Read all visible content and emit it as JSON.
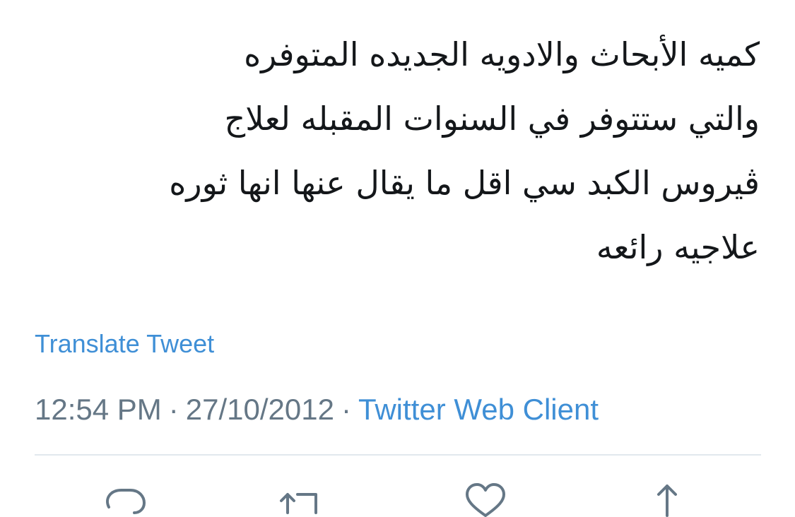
{
  "tweet": {
    "text_lines": [
      "كميه الأبحاث والادويه الجديده المتوفره",
      "والتي ستتوفر في السنوات المقبله لعلاج",
      "ڤيروس الكبد سي اقل ما يقال عنها انها ثوره",
      "علاجيه رائعه"
    ],
    "translate_label": "Translate Tweet",
    "time": "12:54 PM",
    "date": "27/10/2012",
    "separator": "·",
    "client": "Twitter Web Client"
  },
  "actions": {
    "icons": [
      "reply-icon",
      "retweet-icon",
      "like-icon",
      "share-icon"
    ]
  },
  "colors": {
    "text": "#14171a",
    "link": "#3f8fd6",
    "meta": "#657786",
    "divider": "#e1e8ed"
  }
}
